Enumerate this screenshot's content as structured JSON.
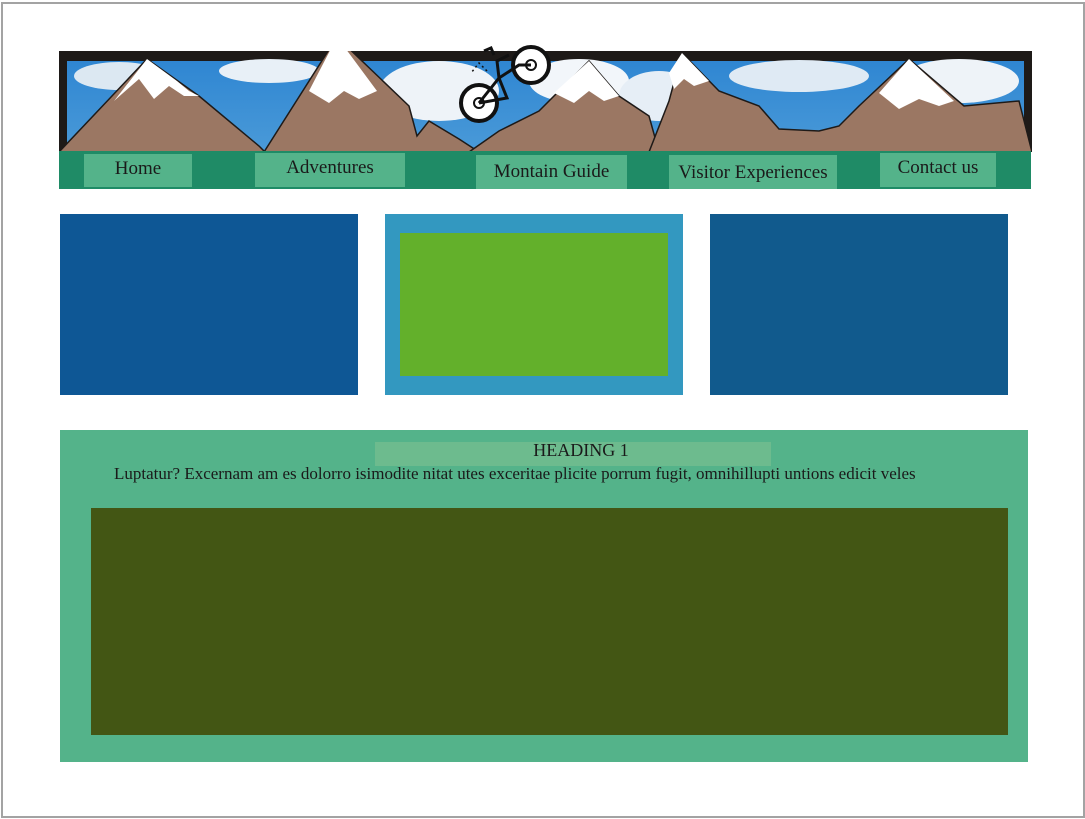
{
  "nav": {
    "items": [
      {
        "label": "Home"
      },
      {
        "label": "Adventures"
      },
      {
        "label": "Montain Guide"
      },
      {
        "label": "Visitor Experiences"
      },
      {
        "label": "Contact us"
      }
    ]
  },
  "content": {
    "heading": "HEADING 1",
    "body": "Luptatur? Excernam am es dolorro isimodite nitat utes exceritae plicite porrum fugit, omnihillupti untions edicit veles"
  },
  "colors": {
    "nav_bar": "#1f8b66",
    "nav_button": "#54b38a",
    "feature_left": "#0e5795",
    "feature_mid_border": "#3398c0",
    "feature_mid_fill": "#63b02b",
    "feature_right": "#115a8d",
    "content_bg": "#54b38a",
    "media_area": "#435614",
    "mountain": "#9b7763",
    "sky": "#3b8ed6"
  },
  "icons": {
    "logo": "mountain-bike-logo-icon"
  }
}
